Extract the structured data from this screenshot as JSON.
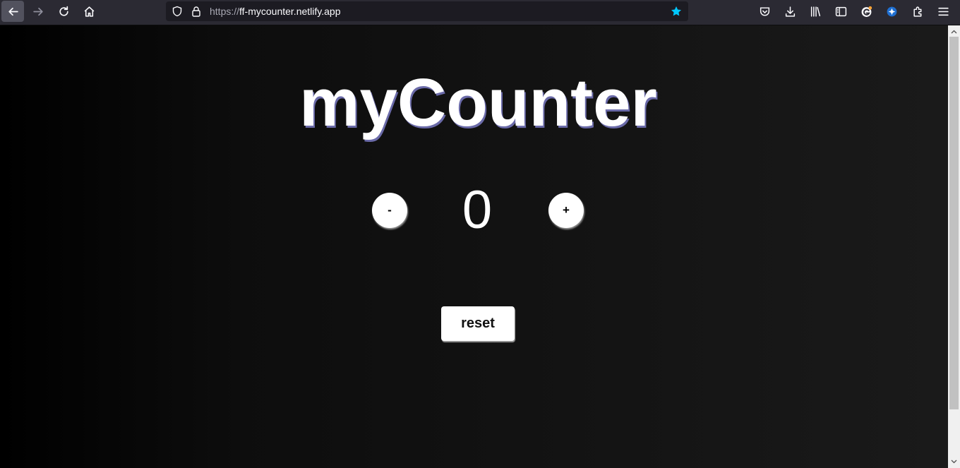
{
  "browser": {
    "url_scheme": "https://",
    "url_host": "ff-mycounter.netlify.app",
    "icons": [
      "back-icon",
      "forward-icon",
      "reload-icon",
      "home-icon",
      "shield-icon",
      "lock-icon",
      "bookmark-star-icon",
      "pocket-icon",
      "download-icon",
      "library-icon",
      "sidebar-icon",
      "account-icon",
      "extension-badge-icon",
      "extensions-icon",
      "menu-icon"
    ],
    "accent_color": "#00c8ff"
  },
  "app": {
    "title": "myCounter",
    "decrement_label": "-",
    "count": "0",
    "increment_label": "+",
    "reset_label": "reset"
  }
}
